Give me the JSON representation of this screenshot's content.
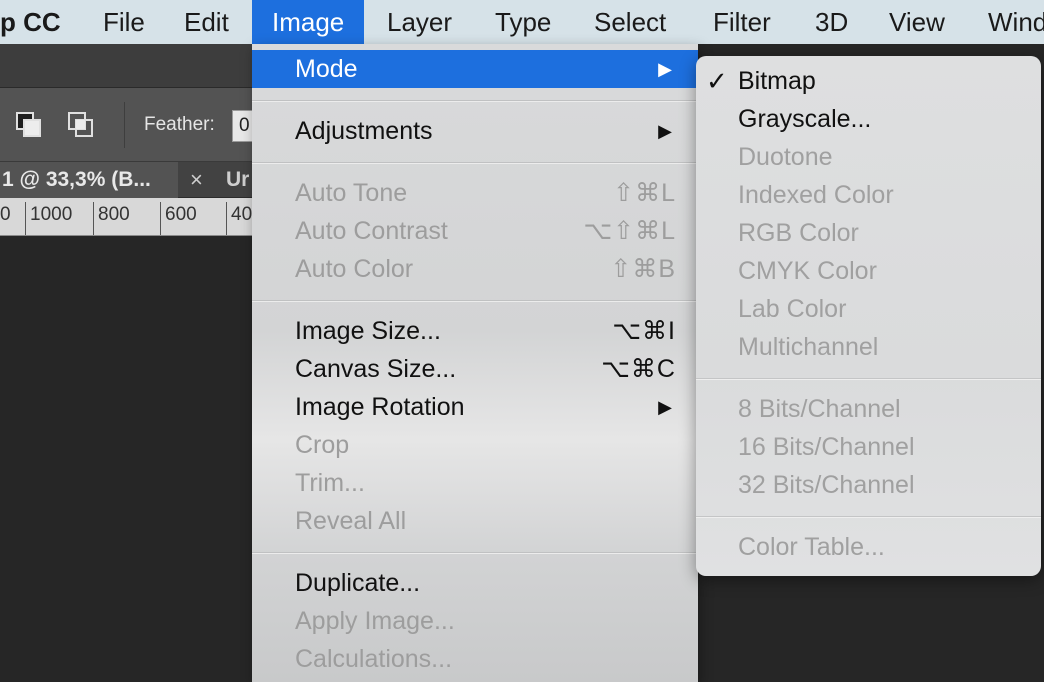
{
  "menubar": {
    "app": "p CC",
    "items": [
      "File",
      "Edit",
      "Image",
      "Layer",
      "Type",
      "Select",
      "Filter",
      "3D",
      "View",
      "Wind"
    ]
  },
  "options_bar": {
    "feather_label": "Feather:",
    "feather_value": "0"
  },
  "doc_tabs": {
    "active": "1 @ 33,3% (B...",
    "close_symbol": "×",
    "other": "Ur"
  },
  "ruler": {
    "ticks": [
      "0",
      "1000",
      "800",
      "600",
      "40"
    ]
  },
  "image_menu": {
    "mode": {
      "label": "Mode",
      "arrow": "▶"
    },
    "adjustments": {
      "label": "Adjustments",
      "arrow": "▶"
    },
    "auto_tone": {
      "label": "Auto Tone",
      "shortcut": "⇧⌘L"
    },
    "auto_contrast": {
      "label": "Auto Contrast",
      "shortcut": "⌥⇧⌘L"
    },
    "auto_color": {
      "label": "Auto Color",
      "shortcut": "⇧⌘B"
    },
    "image_size": {
      "label": "Image Size...",
      "shortcut": "⌥⌘I"
    },
    "canvas_size": {
      "label": "Canvas Size...",
      "shortcut": "⌥⌘C"
    },
    "image_rotation": {
      "label": "Image Rotation",
      "arrow": "▶"
    },
    "crop": {
      "label": "Crop"
    },
    "trim": {
      "label": "Trim..."
    },
    "reveal_all": {
      "label": "Reveal All"
    },
    "duplicate": {
      "label": "Duplicate..."
    },
    "apply_image": {
      "label": "Apply Image..."
    },
    "calculations": {
      "label": "Calculations..."
    }
  },
  "mode_submenu": {
    "check_mark": "✓",
    "bitmap": "Bitmap",
    "grayscale": "Grayscale...",
    "duotone": "Duotone",
    "indexed": "Indexed Color",
    "rgb": "RGB Color",
    "cmyk": "CMYK Color",
    "lab": "Lab Color",
    "multichannel": "Multichannel",
    "bits8": "8 Bits/Channel",
    "bits16": "16 Bits/Channel",
    "bits32": "32 Bits/Channel",
    "color_table": "Color Table..."
  },
  "colors": {
    "highlight": "#1d6fde",
    "menubar": "#d6e2e8",
    "disabled_text": "#9d9d9d"
  }
}
